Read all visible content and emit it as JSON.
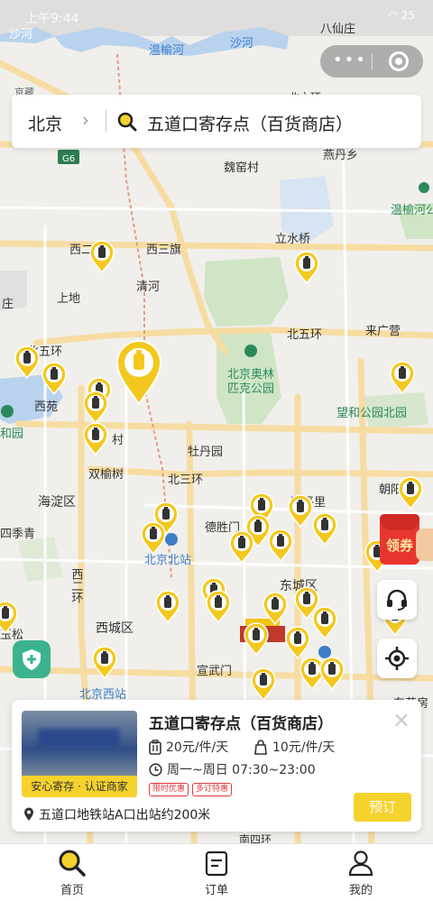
{
  "status": {
    "time": "上午9:44",
    "battery": "25"
  },
  "search": {
    "city": "北京",
    "chevron": "›",
    "query": "五道口寄存点（百货商店）"
  },
  "map": {
    "labels": [
      {
        "text": "沙河",
        "size": 13
      },
      {
        "text": "八仙庄",
        "size": 13
      },
      {
        "text": "温榆河",
        "size": 13,
        "color": "#3c7dc8"
      },
      {
        "text": "沙河",
        "size": 13,
        "color": "#3c7dc8"
      },
      {
        "text": "京藏",
        "size": 11
      },
      {
        "text": "北六环",
        "size": 12
      },
      {
        "text": "燕丹乡",
        "size": 13
      },
      {
        "text": "G6",
        "size": 10
      },
      {
        "text": "魏窑村",
        "size": 13
      },
      {
        "text": "温榆河公园",
        "size": 13,
        "color": "#2a8a5a"
      },
      {
        "text": "西二",
        "size": 13
      },
      {
        "text": "西三旗",
        "size": 13
      },
      {
        "text": "立水桥",
        "size": 13
      },
      {
        "text": "清河",
        "size": 13
      },
      {
        "text": "上地",
        "size": 13
      },
      {
        "text": "庄",
        "size": 13
      },
      {
        "text": "北五环",
        "size": 13
      },
      {
        "text": "来广营",
        "size": 13
      },
      {
        "text": "北五环",
        "size": 13
      },
      {
        "text": "北京奥林",
        "size": 13,
        "color": "#2a8a5a"
      },
      {
        "text": "匹克公园",
        "size": 13,
        "color": "#2a8a5a"
      },
      {
        "text": "西苑",
        "size": 13
      },
      {
        "text": "和园",
        "size": 13,
        "color": "#2a8a5a"
      },
      {
        "text": "望和公园北园",
        "size": 13,
        "color": "#2a8a5a"
      },
      {
        "text": "村",
        "size": 13
      },
      {
        "text": "牡丹园",
        "size": 13
      },
      {
        "text": "双榆树",
        "size": 13
      },
      {
        "text": "北三环",
        "size": 13
      },
      {
        "text": "朝阳",
        "size": 13
      },
      {
        "text": "海淀区",
        "size": 14
      },
      {
        "text": "和平里",
        "size": 13
      },
      {
        "text": "四季青",
        "size": 13
      },
      {
        "text": "德胜门",
        "size": 13
      },
      {
        "text": "北京北站",
        "size": 13,
        "color": "#3c7dc8"
      },
      {
        "text": "西二环",
        "size": 13
      },
      {
        "text": "东城区",
        "size": 14
      },
      {
        "text": "西城区",
        "size": 14
      },
      {
        "text": "宣武门",
        "size": 13
      },
      {
        "text": "玉松",
        "size": 13
      },
      {
        "text": "北京西站",
        "size": 13,
        "color": "#3c7dc8"
      },
      {
        "text": "东花房",
        "size": 13
      },
      {
        "text": "南四环",
        "size": 12
      }
    ]
  },
  "coupon": {
    "label": "领券"
  },
  "card": {
    "name": "五道口寄存点（百货商店）",
    "badge": "安心寄存 · 认证商家",
    "price_luggage": "20元/件/天",
    "price_bag": "10元/件/天",
    "hours": "周一~周日 07:30~23:00",
    "tags": [
      "限时优惠",
      "多订特惠"
    ],
    "address": "五道口地铁站A口出站约200米",
    "book_label": "预订",
    "close_icon": "×"
  },
  "tabs": [
    {
      "label": "首页",
      "icon": "search-icon"
    },
    {
      "label": "订单",
      "icon": "order-icon"
    },
    {
      "label": "我的",
      "icon": "user-icon"
    }
  ],
  "colors": {
    "accent": "#f6d22d",
    "pin": "#f3c81e",
    "water": "#b9d3ee",
    "park": "#cfe5c6",
    "road": "#f7dca2"
  }
}
